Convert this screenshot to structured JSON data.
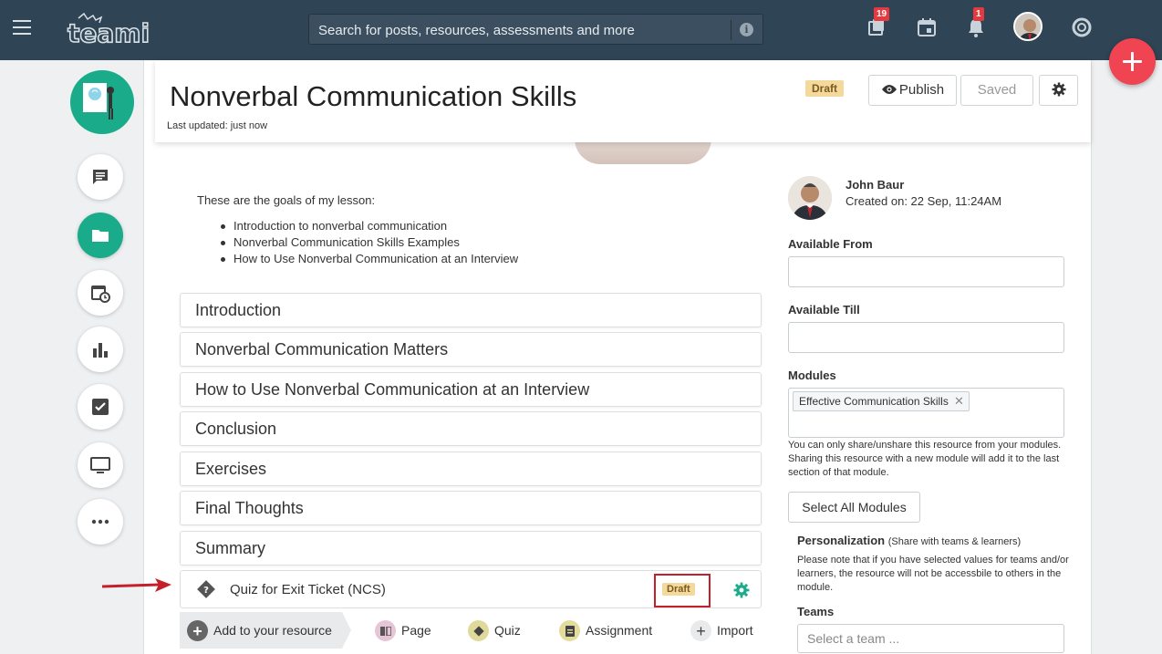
{
  "topbar": {
    "search_placeholder": "Search for posts, resources, assessments and more",
    "library_badge": "19",
    "notifications_badge": "1"
  },
  "colors": {
    "topbar": "#2f4455",
    "accent_green": "#1aab8a",
    "fab_red": "#f04452",
    "draft_tag": "#f4d89c",
    "highlight_border": "#c41f2a"
  },
  "header": {
    "title": "Nonverbal Communication Skills",
    "updated": "Last updated: just now",
    "status": "Draft",
    "publish_label": "Publish",
    "saved_label": "Saved"
  },
  "content": {
    "goals_intro": "These are the goals of my lesson:",
    "goals": [
      "Introduction to nonverbal communication",
      "Nonverbal Communication Skills Examples",
      "How to Use Nonverbal Communication at an Interview"
    ],
    "sections": [
      "Introduction",
      "Nonverbal Communication Matters",
      "How to Use Nonverbal Communication at an Interview",
      "Conclusion",
      "Exercises",
      "Final Thoughts",
      "Summary"
    ],
    "quiz": {
      "label": "Quiz for Exit Ticket (NCS)",
      "status": "Draft"
    },
    "add_bar": {
      "main": "Add to your resource",
      "page": "Page",
      "quiz": "Quiz",
      "assignment": "Assignment",
      "import": "Import"
    }
  },
  "sidebar_right": {
    "author_name": "John Baur",
    "created": "Created on: 22 Sep, 11:24AM",
    "available_from_label": "Available From",
    "available_till_label": "Available Till",
    "modules_label": "Modules",
    "module_chip": "Effective Communication Skills",
    "modules_note": "You can only share/unshare this resource from your modules. Sharing this resource with a new module will add it to the last section of that module.",
    "select_all_label": "Select All Modules",
    "personalization_title": "Personalization",
    "personalization_sub": "(Share with teams & learners)",
    "personalization_note": "Please note that if you have selected values for teams and/or learners, the resource will not be accessbile to others in the module.",
    "teams_label": "Teams",
    "teams_placeholder": "Select a team ..."
  }
}
